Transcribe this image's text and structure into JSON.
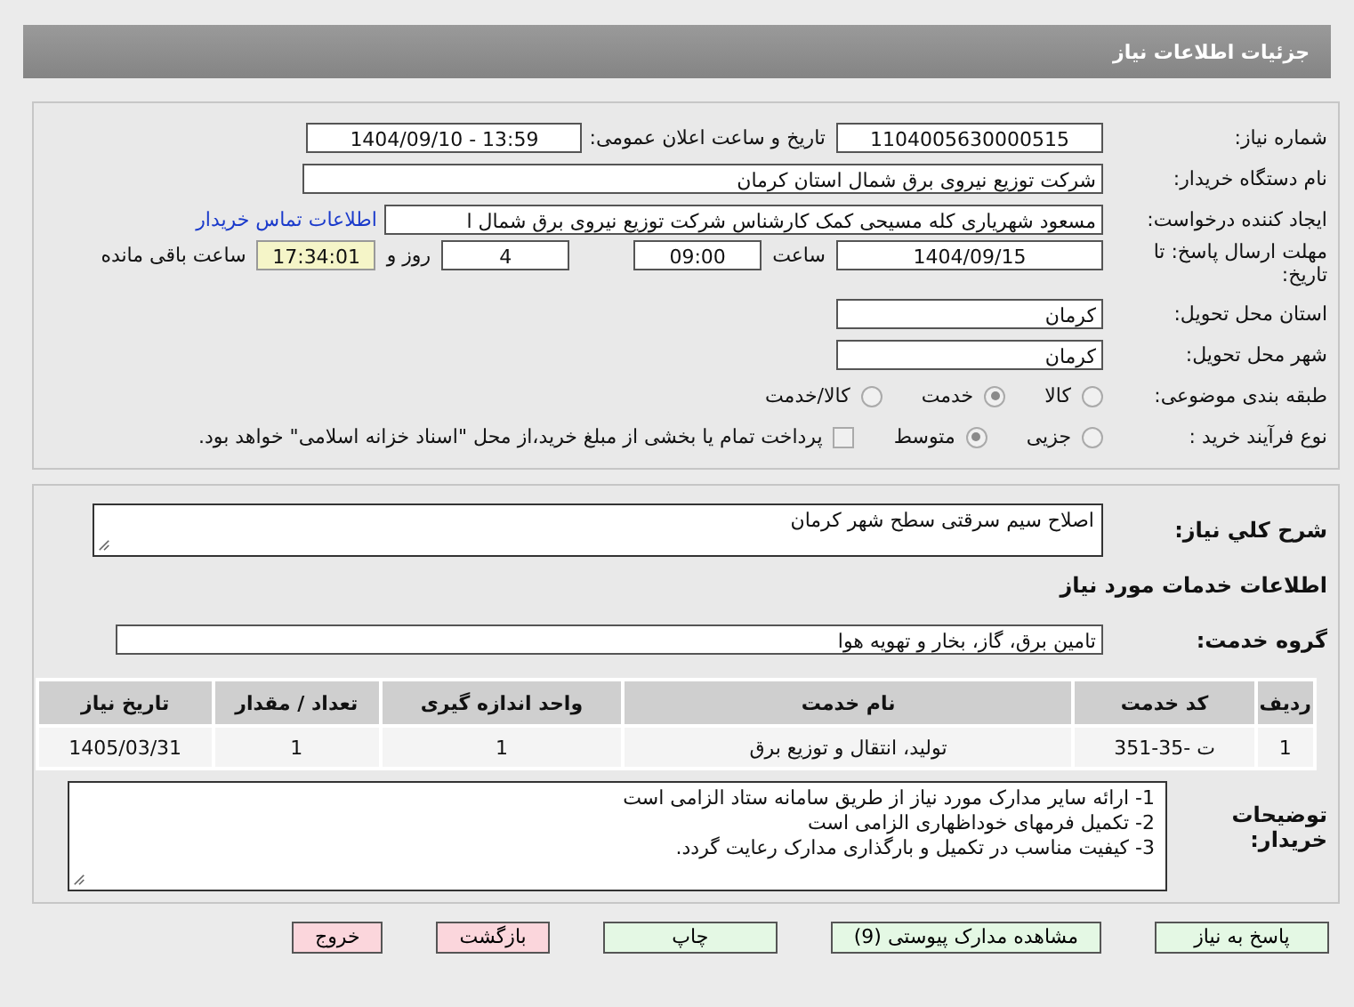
{
  "header": {
    "title": "جزئیات اطلاعات نیاز"
  },
  "need_number": {
    "label": "شماره نیاز:",
    "value": "1104005630000515"
  },
  "announce_datetime": {
    "label": "تاریخ و ساعت اعلان عمومی:",
    "value": "1404/09/10 - 13:59"
  },
  "buyer": {
    "label": "نام دستگاه خریدار:",
    "value": "شرکت توزیع نیروی برق شمال استان کرمان"
  },
  "requester": {
    "label": "ایجاد کننده درخواست:",
    "value": "مسعود شهریاری کله مسیحی کمک کارشناس شرکت توزیع نیروی برق شمال ا",
    "link": "اطلاعات تماس خریدار"
  },
  "deadline": {
    "label": "مهلت ارسال پاسخ: تا تاریخ:",
    "date": "1404/09/15",
    "time_label": "ساعت",
    "time": "09:00",
    "days": "4",
    "days_label": "روز و",
    "remaining": "17:34:01",
    "remaining_label": "ساعت باقی مانده"
  },
  "province": {
    "label": "استان محل تحویل:",
    "value": "کرمان"
  },
  "city": {
    "label": "شهر محل تحویل:",
    "value": "کرمان"
  },
  "category": {
    "label": "طبقه بندی موضوعی:",
    "options": [
      {
        "label": "کالا",
        "selected": false
      },
      {
        "label": "خدمت",
        "selected": true
      },
      {
        "label": "کالا/خدمت",
        "selected": false
      }
    ]
  },
  "process": {
    "label": "نوع فرآیند خرید :",
    "options": [
      {
        "label": "جزیی",
        "selected": false
      },
      {
        "label": "متوسط",
        "selected": true
      }
    ],
    "payment": {
      "checked": false,
      "text": "پرداخت تمام یا بخشی از مبلغ خرید،از محل \"اسناد خزانه اسلامی\" خواهد بود."
    }
  },
  "summary": {
    "label": "شرح کلي نياز:",
    "value": "اصلاح سیم سرقتی سطح شهر کرمان"
  },
  "services_title": "اطلاعات خدمات مورد نیاز",
  "service_group": {
    "label": "گروه خدمت:",
    "value": "تامین برق، گاز، بخار و تهویه هوا"
  },
  "table": {
    "columns": [
      "ردیف",
      "کد خدمت",
      "نام خدمت",
      "واحد اندازه گیری",
      "تعداد / مقدار",
      "تاریخ نیاز"
    ],
    "rows": [
      [
        "1",
        "ت -35-351",
        "تولید، انتقال و توزیع برق",
        "1",
        "1",
        "1405/03/31"
      ]
    ]
  },
  "notes": {
    "label": "توضیحات خریدار:",
    "lines": [
      "1- ارائه سایر مدارک مورد نیاز از طریق سامانه ستاد الزامی است",
      "2- تکمیل فرمهای خوداظهاری الزامی است",
      "3- کیفیت مناسب در تکمیل و بارگذاری مدارک رعایت گردد."
    ]
  },
  "buttons": [
    {
      "label": "پاسخ به نیاز",
      "kind": "go"
    },
    {
      "label": "مشاهده مدارک پیوستی (9)",
      "kind": "go"
    },
    {
      "label": "چاپ",
      "kind": "go"
    },
    {
      "label": "بازگشت",
      "kind": "stop"
    },
    {
      "label": "خروج",
      "kind": "stop"
    }
  ]
}
